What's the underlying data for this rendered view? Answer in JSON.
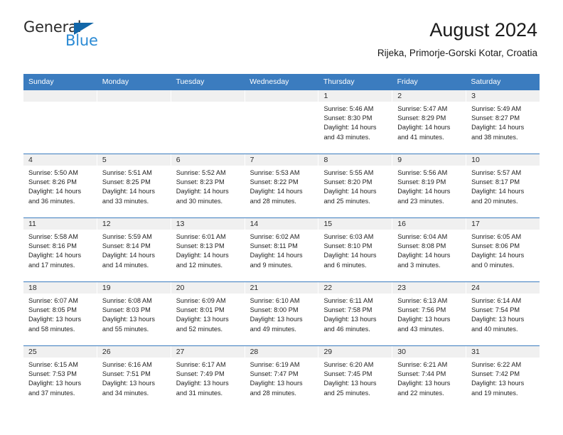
{
  "logo": {
    "word_top": "General",
    "word_bottom": "Blue",
    "triangle_icon": "blue-triangle-icon",
    "color_dark": "#2b2b2b",
    "color_blue": "#2a8ad4",
    "triangle_color": "#1266a8"
  },
  "header": {
    "title": "August 2024",
    "subtitle": "Rijeka, Primorje-Gorski Kotar, Croatia"
  },
  "theme": {
    "header_bar": "#3b7cbf",
    "date_band": "#f0f0f0",
    "cell_bg": "#ffffff"
  },
  "weekdays": [
    "Sunday",
    "Monday",
    "Tuesday",
    "Wednesday",
    "Thursday",
    "Friday",
    "Saturday"
  ],
  "weeks": [
    [
      {
        "date": "",
        "empty": true
      },
      {
        "date": "",
        "empty": true
      },
      {
        "date": "",
        "empty": true
      },
      {
        "date": "",
        "empty": true
      },
      {
        "date": "1",
        "sunrise": "Sunrise: 5:46 AM",
        "sunset": "Sunset: 8:30 PM",
        "daylight1": "Daylight: 14 hours",
        "daylight2": "and 43 minutes."
      },
      {
        "date": "2",
        "sunrise": "Sunrise: 5:47 AM",
        "sunset": "Sunset: 8:29 PM",
        "daylight1": "Daylight: 14 hours",
        "daylight2": "and 41 minutes."
      },
      {
        "date": "3",
        "sunrise": "Sunrise: 5:49 AM",
        "sunset": "Sunset: 8:27 PM",
        "daylight1": "Daylight: 14 hours",
        "daylight2": "and 38 minutes."
      }
    ],
    [
      {
        "date": "4",
        "sunrise": "Sunrise: 5:50 AM",
        "sunset": "Sunset: 8:26 PM",
        "daylight1": "Daylight: 14 hours",
        "daylight2": "and 36 minutes."
      },
      {
        "date": "5",
        "sunrise": "Sunrise: 5:51 AM",
        "sunset": "Sunset: 8:25 PM",
        "daylight1": "Daylight: 14 hours",
        "daylight2": "and 33 minutes."
      },
      {
        "date": "6",
        "sunrise": "Sunrise: 5:52 AM",
        "sunset": "Sunset: 8:23 PM",
        "daylight1": "Daylight: 14 hours",
        "daylight2": "and 30 minutes."
      },
      {
        "date": "7",
        "sunrise": "Sunrise: 5:53 AM",
        "sunset": "Sunset: 8:22 PM",
        "daylight1": "Daylight: 14 hours",
        "daylight2": "and 28 minutes."
      },
      {
        "date": "8",
        "sunrise": "Sunrise: 5:55 AM",
        "sunset": "Sunset: 8:20 PM",
        "daylight1": "Daylight: 14 hours",
        "daylight2": "and 25 minutes."
      },
      {
        "date": "9",
        "sunrise": "Sunrise: 5:56 AM",
        "sunset": "Sunset: 8:19 PM",
        "daylight1": "Daylight: 14 hours",
        "daylight2": "and 23 minutes."
      },
      {
        "date": "10",
        "sunrise": "Sunrise: 5:57 AM",
        "sunset": "Sunset: 8:17 PM",
        "daylight1": "Daylight: 14 hours",
        "daylight2": "and 20 minutes."
      }
    ],
    [
      {
        "date": "11",
        "sunrise": "Sunrise: 5:58 AM",
        "sunset": "Sunset: 8:16 PM",
        "daylight1": "Daylight: 14 hours",
        "daylight2": "and 17 minutes."
      },
      {
        "date": "12",
        "sunrise": "Sunrise: 5:59 AM",
        "sunset": "Sunset: 8:14 PM",
        "daylight1": "Daylight: 14 hours",
        "daylight2": "and 14 minutes."
      },
      {
        "date": "13",
        "sunrise": "Sunrise: 6:01 AM",
        "sunset": "Sunset: 8:13 PM",
        "daylight1": "Daylight: 14 hours",
        "daylight2": "and 12 minutes."
      },
      {
        "date": "14",
        "sunrise": "Sunrise: 6:02 AM",
        "sunset": "Sunset: 8:11 PM",
        "daylight1": "Daylight: 14 hours",
        "daylight2": "and 9 minutes."
      },
      {
        "date": "15",
        "sunrise": "Sunrise: 6:03 AM",
        "sunset": "Sunset: 8:10 PM",
        "daylight1": "Daylight: 14 hours",
        "daylight2": "and 6 minutes."
      },
      {
        "date": "16",
        "sunrise": "Sunrise: 6:04 AM",
        "sunset": "Sunset: 8:08 PM",
        "daylight1": "Daylight: 14 hours",
        "daylight2": "and 3 minutes."
      },
      {
        "date": "17",
        "sunrise": "Sunrise: 6:05 AM",
        "sunset": "Sunset: 8:06 PM",
        "daylight1": "Daylight: 14 hours",
        "daylight2": "and 0 minutes."
      }
    ],
    [
      {
        "date": "18",
        "sunrise": "Sunrise: 6:07 AM",
        "sunset": "Sunset: 8:05 PM",
        "daylight1": "Daylight: 13 hours",
        "daylight2": "and 58 minutes."
      },
      {
        "date": "19",
        "sunrise": "Sunrise: 6:08 AM",
        "sunset": "Sunset: 8:03 PM",
        "daylight1": "Daylight: 13 hours",
        "daylight2": "and 55 minutes."
      },
      {
        "date": "20",
        "sunrise": "Sunrise: 6:09 AM",
        "sunset": "Sunset: 8:01 PM",
        "daylight1": "Daylight: 13 hours",
        "daylight2": "and 52 minutes."
      },
      {
        "date": "21",
        "sunrise": "Sunrise: 6:10 AM",
        "sunset": "Sunset: 8:00 PM",
        "daylight1": "Daylight: 13 hours",
        "daylight2": "and 49 minutes."
      },
      {
        "date": "22",
        "sunrise": "Sunrise: 6:11 AM",
        "sunset": "Sunset: 7:58 PM",
        "daylight1": "Daylight: 13 hours",
        "daylight2": "and 46 minutes."
      },
      {
        "date": "23",
        "sunrise": "Sunrise: 6:13 AM",
        "sunset": "Sunset: 7:56 PM",
        "daylight1": "Daylight: 13 hours",
        "daylight2": "and 43 minutes."
      },
      {
        "date": "24",
        "sunrise": "Sunrise: 6:14 AM",
        "sunset": "Sunset: 7:54 PM",
        "daylight1": "Daylight: 13 hours",
        "daylight2": "and 40 minutes."
      }
    ],
    [
      {
        "date": "25",
        "sunrise": "Sunrise: 6:15 AM",
        "sunset": "Sunset: 7:53 PM",
        "daylight1": "Daylight: 13 hours",
        "daylight2": "and 37 minutes."
      },
      {
        "date": "26",
        "sunrise": "Sunrise: 6:16 AM",
        "sunset": "Sunset: 7:51 PM",
        "daylight1": "Daylight: 13 hours",
        "daylight2": "and 34 minutes."
      },
      {
        "date": "27",
        "sunrise": "Sunrise: 6:17 AM",
        "sunset": "Sunset: 7:49 PM",
        "daylight1": "Daylight: 13 hours",
        "daylight2": "and 31 minutes."
      },
      {
        "date": "28",
        "sunrise": "Sunrise: 6:19 AM",
        "sunset": "Sunset: 7:47 PM",
        "daylight1": "Daylight: 13 hours",
        "daylight2": "and 28 minutes."
      },
      {
        "date": "29",
        "sunrise": "Sunrise: 6:20 AM",
        "sunset": "Sunset: 7:45 PM",
        "daylight1": "Daylight: 13 hours",
        "daylight2": "and 25 minutes."
      },
      {
        "date": "30",
        "sunrise": "Sunrise: 6:21 AM",
        "sunset": "Sunset: 7:44 PM",
        "daylight1": "Daylight: 13 hours",
        "daylight2": "and 22 minutes."
      },
      {
        "date": "31",
        "sunrise": "Sunrise: 6:22 AM",
        "sunset": "Sunset: 7:42 PM",
        "daylight1": "Daylight: 13 hours",
        "daylight2": "and 19 minutes."
      }
    ]
  ]
}
